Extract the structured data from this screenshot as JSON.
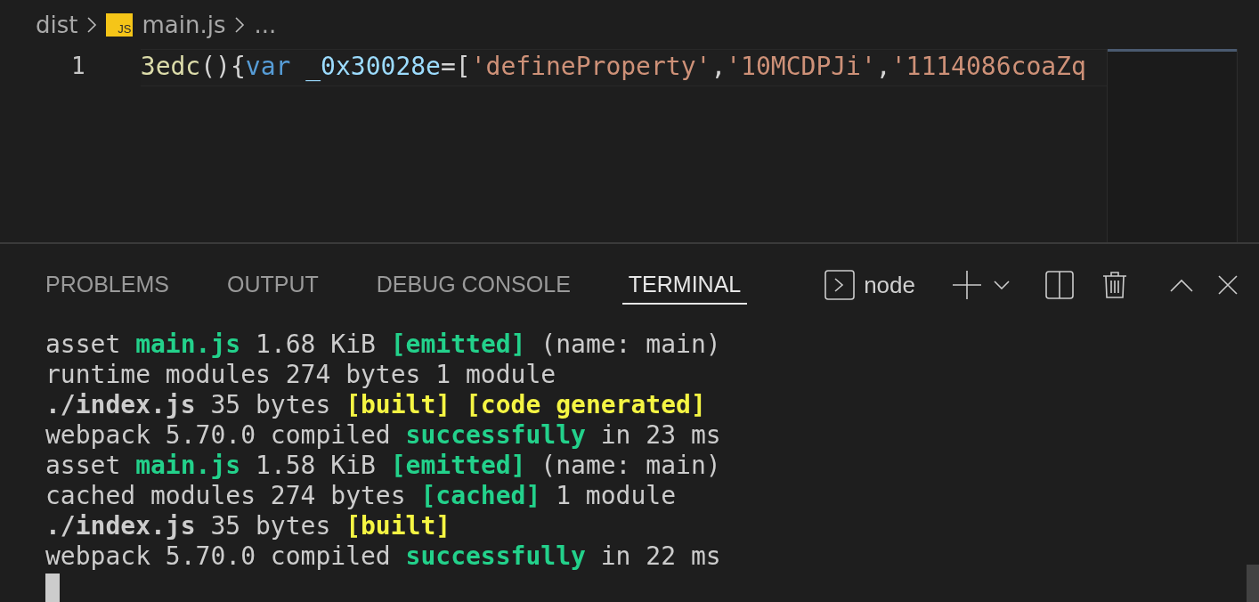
{
  "breadcrumb": {
    "items": [
      "dist",
      "main.js"
    ],
    "ellipsis": "...",
    "file_icon_text": "JS"
  },
  "editor": {
    "line_number": "1",
    "tokens": [
      {
        "kind": "fn",
        "text": "3edc"
      },
      {
        "kind": "punct",
        "text": "(){"
      },
      {
        "kind": "keyword",
        "text": "var "
      },
      {
        "kind": "var",
        "text": "_0x30028e"
      },
      {
        "kind": "punct",
        "text": "=["
      },
      {
        "kind": "string",
        "text": "'defineProperty'"
      },
      {
        "kind": "punct",
        "text": ","
      },
      {
        "kind": "string",
        "text": "'10MCDPJi'"
      },
      {
        "kind": "punct",
        "text": ","
      },
      {
        "kind": "string",
        "text": "'1114086coaZq"
      }
    ]
  },
  "panel": {
    "tabs": [
      {
        "label": "PROBLEMS",
        "selected": false
      },
      {
        "label": "OUTPUT",
        "selected": false
      },
      {
        "label": "DEBUG CONSOLE",
        "selected": false
      },
      {
        "label": "TERMINAL",
        "selected": true
      }
    ],
    "terminal_name": "node"
  },
  "terminal": {
    "lines": [
      [
        {
          "kind": "plain",
          "text": "asset "
        },
        {
          "kind": "green",
          "text": "main.js"
        },
        {
          "kind": "plain",
          "text": " 1.68 KiB "
        },
        {
          "kind": "green",
          "text": "[emitted]"
        },
        {
          "kind": "plain",
          "text": " (name: main)"
        }
      ],
      [
        {
          "kind": "plain",
          "text": "runtime modules 274 bytes 1 module"
        }
      ],
      [
        {
          "kind": "bold",
          "text": "./index.js"
        },
        {
          "kind": "plain",
          "text": " 35 bytes "
        },
        {
          "kind": "yellow",
          "text": "[built] [code generated]"
        }
      ],
      [
        {
          "kind": "plain",
          "text": "webpack 5.70.0 compiled "
        },
        {
          "kind": "green",
          "text": "successfully"
        },
        {
          "kind": "plain",
          "text": " in 23 ms"
        }
      ],
      [
        {
          "kind": "plain",
          "text": "asset "
        },
        {
          "kind": "green",
          "text": "main.js"
        },
        {
          "kind": "plain",
          "text": " 1.58 KiB "
        },
        {
          "kind": "green",
          "text": "[emitted]"
        },
        {
          "kind": "plain",
          "text": " (name: main)"
        }
      ],
      [
        {
          "kind": "plain",
          "text": "cached modules 274 bytes "
        },
        {
          "kind": "green",
          "text": "[cached]"
        },
        {
          "kind": "plain",
          "text": " 1 module"
        }
      ],
      [
        {
          "kind": "bold",
          "text": "./index.js"
        },
        {
          "kind": "plain",
          "text": " 35 bytes "
        },
        {
          "kind": "yellow",
          "text": "[built]"
        }
      ],
      [
        {
          "kind": "plain",
          "text": "webpack 5.70.0 compiled "
        },
        {
          "kind": "green",
          "text": "successfully"
        },
        {
          "kind": "plain",
          "text": " in 22 ms"
        }
      ]
    ]
  }
}
